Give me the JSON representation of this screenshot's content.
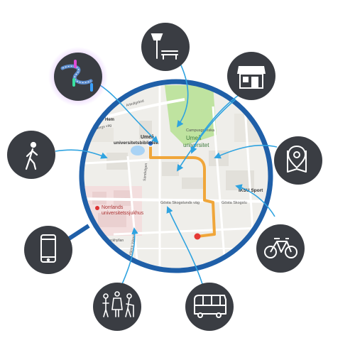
{
  "colors": {
    "ring": "#1f5fa8",
    "icon_bg": "#3a3d43",
    "arrow": "#2fa3e0",
    "route": "#f0a63a",
    "destination": "#e53935",
    "map_base": "#efeeea",
    "park": "#bfe3a0",
    "water": "#a9d3f5"
  },
  "map": {
    "labels": {
      "umea_universitetsbibliotek_line1": "Umeå",
      "umea_universitetsbibliotek_line2": "universitetsbibliotek",
      "umea_universitet_line1": "Umeå",
      "umea_universitet_line2": "universitet",
      "campus_label": "Campusgrönska",
      "norrlands_line1": "Norrlands",
      "norrlands_line2": "universitetssjukhus",
      "iksu": "IKSU Sport",
      "gosta_skogslunds_vag": "Gösta Skogslunds väg",
      "gosta_skogsl": "Gösta Skogslu",
      "hem": "Hem",
      "artedigrand": "Artedigränd",
      "lirbergs_vag": "lirbergs väg",
      "kuckhyllan": "Kuckhyllan",
      "stadsdel": "Sandvägen",
      "vastra": "Västra Vägen"
    }
  },
  "icons": [
    {
      "name": "street-lamp-bench-icon"
    },
    {
      "name": "shop-icon"
    },
    {
      "name": "map-pin-icon"
    },
    {
      "name": "bicycle-icon"
    },
    {
      "name": "bus-icon"
    },
    {
      "name": "people-icon"
    },
    {
      "name": "smartphone-icon"
    },
    {
      "name": "walking-person-icon"
    },
    {
      "name": "route-icon"
    }
  ]
}
